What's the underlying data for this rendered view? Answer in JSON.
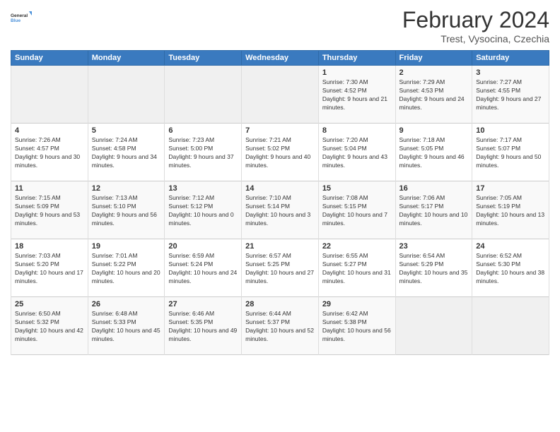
{
  "logo": {
    "line1": "General",
    "line2": "Blue"
  },
  "title": "February 2024",
  "subtitle": "Trest, Vysocina, Czechia",
  "weekdays": [
    "Sunday",
    "Monday",
    "Tuesday",
    "Wednesday",
    "Thursday",
    "Friday",
    "Saturday"
  ],
  "rows": [
    [
      {
        "day": "",
        "empty": true
      },
      {
        "day": "",
        "empty": true
      },
      {
        "day": "",
        "empty": true
      },
      {
        "day": "",
        "empty": true
      },
      {
        "day": "1",
        "sunrise": "7:30 AM",
        "sunset": "4:52 PM",
        "daylight": "9 hours and 21 minutes."
      },
      {
        "day": "2",
        "sunrise": "7:29 AM",
        "sunset": "4:53 PM",
        "daylight": "9 hours and 24 minutes."
      },
      {
        "day": "3",
        "sunrise": "7:27 AM",
        "sunset": "4:55 PM",
        "daylight": "9 hours and 27 minutes."
      }
    ],
    [
      {
        "day": "4",
        "sunrise": "7:26 AM",
        "sunset": "4:57 PM",
        "daylight": "9 hours and 30 minutes."
      },
      {
        "day": "5",
        "sunrise": "7:24 AM",
        "sunset": "4:58 PM",
        "daylight": "9 hours and 34 minutes."
      },
      {
        "day": "6",
        "sunrise": "7:23 AM",
        "sunset": "5:00 PM",
        "daylight": "9 hours and 37 minutes."
      },
      {
        "day": "7",
        "sunrise": "7:21 AM",
        "sunset": "5:02 PM",
        "daylight": "9 hours and 40 minutes."
      },
      {
        "day": "8",
        "sunrise": "7:20 AM",
        "sunset": "5:04 PM",
        "daylight": "9 hours and 43 minutes."
      },
      {
        "day": "9",
        "sunrise": "7:18 AM",
        "sunset": "5:05 PM",
        "daylight": "9 hours and 46 minutes."
      },
      {
        "day": "10",
        "sunrise": "7:17 AM",
        "sunset": "5:07 PM",
        "daylight": "9 hours and 50 minutes."
      }
    ],
    [
      {
        "day": "11",
        "sunrise": "7:15 AM",
        "sunset": "5:09 PM",
        "daylight": "9 hours and 53 minutes."
      },
      {
        "day": "12",
        "sunrise": "7:13 AM",
        "sunset": "5:10 PM",
        "daylight": "9 hours and 56 minutes."
      },
      {
        "day": "13",
        "sunrise": "7:12 AM",
        "sunset": "5:12 PM",
        "daylight": "10 hours and 0 minutes."
      },
      {
        "day": "14",
        "sunrise": "7:10 AM",
        "sunset": "5:14 PM",
        "daylight": "10 hours and 3 minutes."
      },
      {
        "day": "15",
        "sunrise": "7:08 AM",
        "sunset": "5:15 PM",
        "daylight": "10 hours and 7 minutes."
      },
      {
        "day": "16",
        "sunrise": "7:06 AM",
        "sunset": "5:17 PM",
        "daylight": "10 hours and 10 minutes."
      },
      {
        "day": "17",
        "sunrise": "7:05 AM",
        "sunset": "5:19 PM",
        "daylight": "10 hours and 13 minutes."
      }
    ],
    [
      {
        "day": "18",
        "sunrise": "7:03 AM",
        "sunset": "5:20 PM",
        "daylight": "10 hours and 17 minutes."
      },
      {
        "day": "19",
        "sunrise": "7:01 AM",
        "sunset": "5:22 PM",
        "daylight": "10 hours and 20 minutes."
      },
      {
        "day": "20",
        "sunrise": "6:59 AM",
        "sunset": "5:24 PM",
        "daylight": "10 hours and 24 minutes."
      },
      {
        "day": "21",
        "sunrise": "6:57 AM",
        "sunset": "5:25 PM",
        "daylight": "10 hours and 27 minutes."
      },
      {
        "day": "22",
        "sunrise": "6:55 AM",
        "sunset": "5:27 PM",
        "daylight": "10 hours and 31 minutes."
      },
      {
        "day": "23",
        "sunrise": "6:54 AM",
        "sunset": "5:29 PM",
        "daylight": "10 hours and 35 minutes."
      },
      {
        "day": "24",
        "sunrise": "6:52 AM",
        "sunset": "5:30 PM",
        "daylight": "10 hours and 38 minutes."
      }
    ],
    [
      {
        "day": "25",
        "sunrise": "6:50 AM",
        "sunset": "5:32 PM",
        "daylight": "10 hours and 42 minutes."
      },
      {
        "day": "26",
        "sunrise": "6:48 AM",
        "sunset": "5:33 PM",
        "daylight": "10 hours and 45 minutes."
      },
      {
        "day": "27",
        "sunrise": "6:46 AM",
        "sunset": "5:35 PM",
        "daylight": "10 hours and 49 minutes."
      },
      {
        "day": "28",
        "sunrise": "6:44 AM",
        "sunset": "5:37 PM",
        "daylight": "10 hours and 52 minutes."
      },
      {
        "day": "29",
        "sunrise": "6:42 AM",
        "sunset": "5:38 PM",
        "daylight": "10 hours and 56 minutes."
      },
      {
        "day": "",
        "empty": true
      },
      {
        "day": "",
        "empty": true
      }
    ]
  ],
  "labels": {
    "sunrise": "Sunrise:",
    "sunset": "Sunset:",
    "daylight": "Daylight:"
  }
}
